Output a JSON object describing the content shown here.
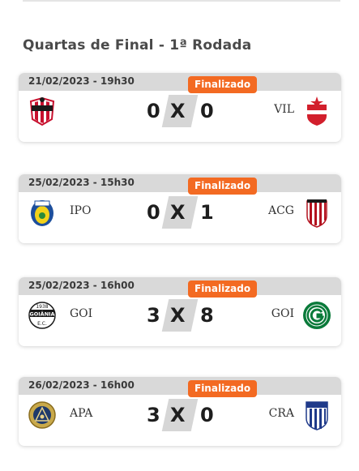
{
  "round_title": "Quartas de Final - 1ª Rodada",
  "separator": "X",
  "colors": {
    "header_bg": "#d9d9d9",
    "badge": "#f36a22",
    "x_bg": "#d6d6d6"
  },
  "matches": [
    {
      "date": "21/02/2023 - 19h30",
      "status": "Finalizado",
      "home": {
        "abbr": "",
        "score": "0",
        "crest": "anapolis-crest-icon"
      },
      "away": {
        "abbr": "VIL",
        "score": "0",
        "crest": "vila-nova-crest-icon"
      }
    },
    {
      "date": "25/02/2023 - 15h30",
      "status": "Finalizado",
      "home": {
        "abbr": "IPO",
        "score": "0",
        "crest": "ipora-crest-icon"
      },
      "away": {
        "abbr": "ACG",
        "score": "1",
        "crest": "atletico-go-crest-icon"
      }
    },
    {
      "date": "25/02/2023 - 16h00",
      "status": "Finalizado",
      "home": {
        "abbr": "GOI",
        "score": "3",
        "crest": "goiania-ec-crest-icon"
      },
      "away": {
        "abbr": "GOI",
        "score": "8",
        "crest": "goias-crest-icon"
      }
    },
    {
      "date": "26/02/2023 - 16h00",
      "status": "Finalizado",
      "home": {
        "abbr": "APA",
        "score": "3",
        "crest": "aparecidense-crest-icon"
      },
      "away": {
        "abbr": "CRA",
        "score": "0",
        "crest": "crac-crest-icon"
      }
    }
  ]
}
